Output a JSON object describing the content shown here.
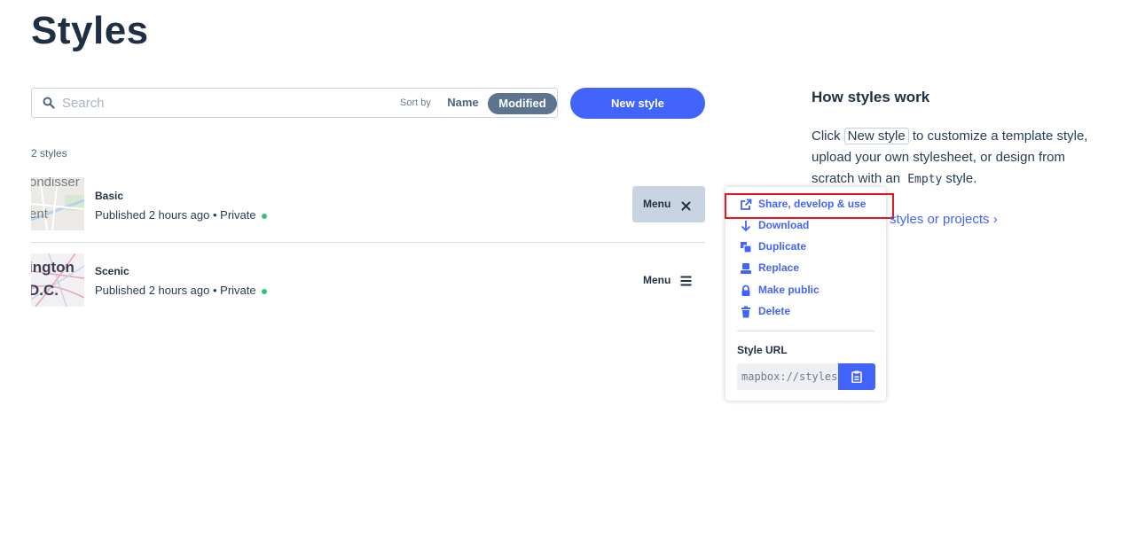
{
  "page": {
    "title": "Styles"
  },
  "search": {
    "placeholder": "Search",
    "value": ""
  },
  "sort": {
    "label": "Sort by",
    "options": [
      "Name",
      "Modified"
    ],
    "selected": "Modified"
  },
  "new_style_button": "New style",
  "styles_count": "2 styles",
  "styles": [
    {
      "name": "Basic",
      "meta": "Published 2 hours ago • Private",
      "menu_label": "Menu",
      "menu_open": true,
      "thumb_text_1": "ondisser",
      "thumb_text_2": "ent"
    },
    {
      "name": "Scenic",
      "meta": "Published 2 hours ago • Private",
      "menu_label": "Menu",
      "menu_open": false,
      "thumb_text_1": "ington",
      "thumb_text_2": "D.C."
    }
  ],
  "dropdown": {
    "items": [
      {
        "label": "Share, develop & use",
        "icon": "external-link-icon"
      },
      {
        "label": "Download",
        "icon": "download-arrow-icon"
      },
      {
        "label": "Duplicate",
        "icon": "duplicate-icon"
      },
      {
        "label": "Replace",
        "icon": "replace-icon"
      },
      {
        "label": "Make public",
        "icon": "lock-icon"
      },
      {
        "label": "Delete",
        "icon": "trash-icon"
      }
    ],
    "style_url_label": "Style URL",
    "style_url_value": "mapbox://styles/",
    "copy_icon": "clipboard-icon"
  },
  "help": {
    "title": "How styles work",
    "text_1": "Click",
    "new_style_chip": "New style",
    "text_2": "to customize a template style, upload your own stylesheet, or design from scratch with an",
    "empty_code": "Empty",
    "text_3": "style.",
    "link_text": "styles or projects",
    "link_chevron": "›"
  },
  "colors": {
    "accent": "#4264fb",
    "title": "#1f2f44",
    "sort_selected_bg": "#5d7491",
    "status_dot": "#33c377",
    "highlight": "#e8141e"
  }
}
